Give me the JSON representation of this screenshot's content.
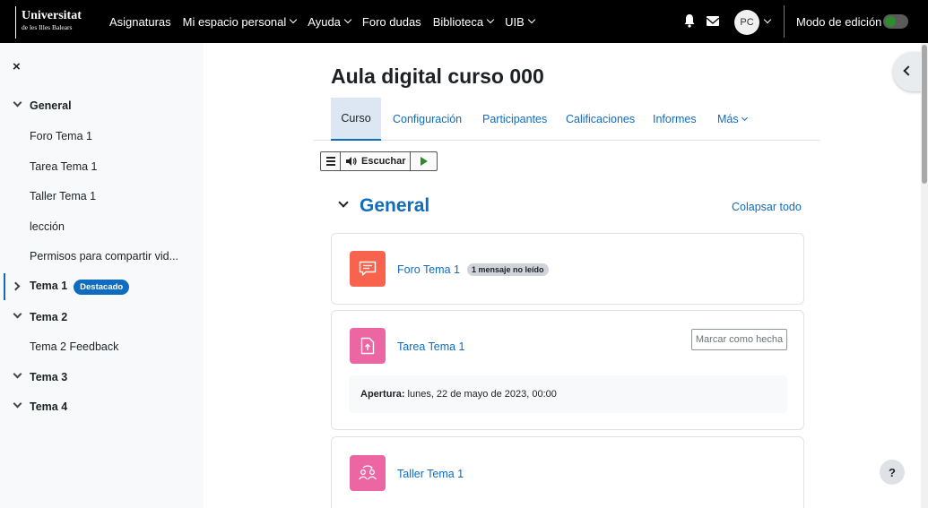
{
  "logo": {
    "main": "Universitat",
    "sub": "de les Illes Balears"
  },
  "nav": {
    "links": [
      {
        "label": "Asignaturas",
        "caret": false
      },
      {
        "label": "Mi espacio personal",
        "caret": true
      },
      {
        "label": "Ayuda",
        "caret": true
      },
      {
        "label": "Foro dudas",
        "caret": false
      },
      {
        "label": "Biblioteca",
        "caret": true
      },
      {
        "label": "UIB",
        "caret": true
      }
    ],
    "avatar_initials": "PC",
    "edit_mode_label": "Modo de edición"
  },
  "drawer": {
    "close_glyph": "×",
    "items": [
      {
        "label": "General",
        "type": "section"
      },
      {
        "label": "Foro Tema 1",
        "type": "item"
      },
      {
        "label": "Tarea Tema 1",
        "type": "item"
      },
      {
        "label": "Taller Tema 1",
        "type": "item"
      },
      {
        "label": "lección",
        "type": "item"
      },
      {
        "label": "Permisos para compartir vid...",
        "type": "item"
      },
      {
        "label": "Tema 1",
        "type": "section",
        "badge": "Destacado"
      },
      {
        "label": "Tema 2",
        "type": "section"
      },
      {
        "label": "Tema 2 Feedback",
        "type": "item"
      },
      {
        "label": "Tema 3",
        "type": "section"
      },
      {
        "label": "Tema 4",
        "type": "section"
      }
    ]
  },
  "main": {
    "title": "Aula digital curso 000",
    "tabs": [
      {
        "label": "Curso"
      },
      {
        "label": "Configuración"
      },
      {
        "label": "Participantes"
      },
      {
        "label": "Calificaciones"
      },
      {
        "label": "Informes"
      },
      {
        "label": "Más"
      }
    ],
    "listen_label": "Escuchar",
    "section_title": "General",
    "collapse_all": "Colapsar todo",
    "activities": [
      {
        "name": "Foro Tema 1",
        "unread_badge": "1 mensaje no leído",
        "icon": "forum-icon",
        "color": "#f7634d"
      },
      {
        "name": "Tarea Tema 1",
        "mark_done": "Marcar como hecha",
        "dates_label": "Apertura:",
        "dates_value": "lunes, 22 de mayo de 2023, 00:00",
        "icon": "assignment-icon",
        "color": "#eb66a2"
      },
      {
        "name": "Taller Tema 1",
        "icon": "workshop-icon",
        "color": "#eb66a2"
      }
    ],
    "help_glyph": "?"
  },
  "colors": {
    "brand": "#0f6cbf",
    "navbar": "#000000",
    "drawer_bg": "#f8f9fa"
  }
}
